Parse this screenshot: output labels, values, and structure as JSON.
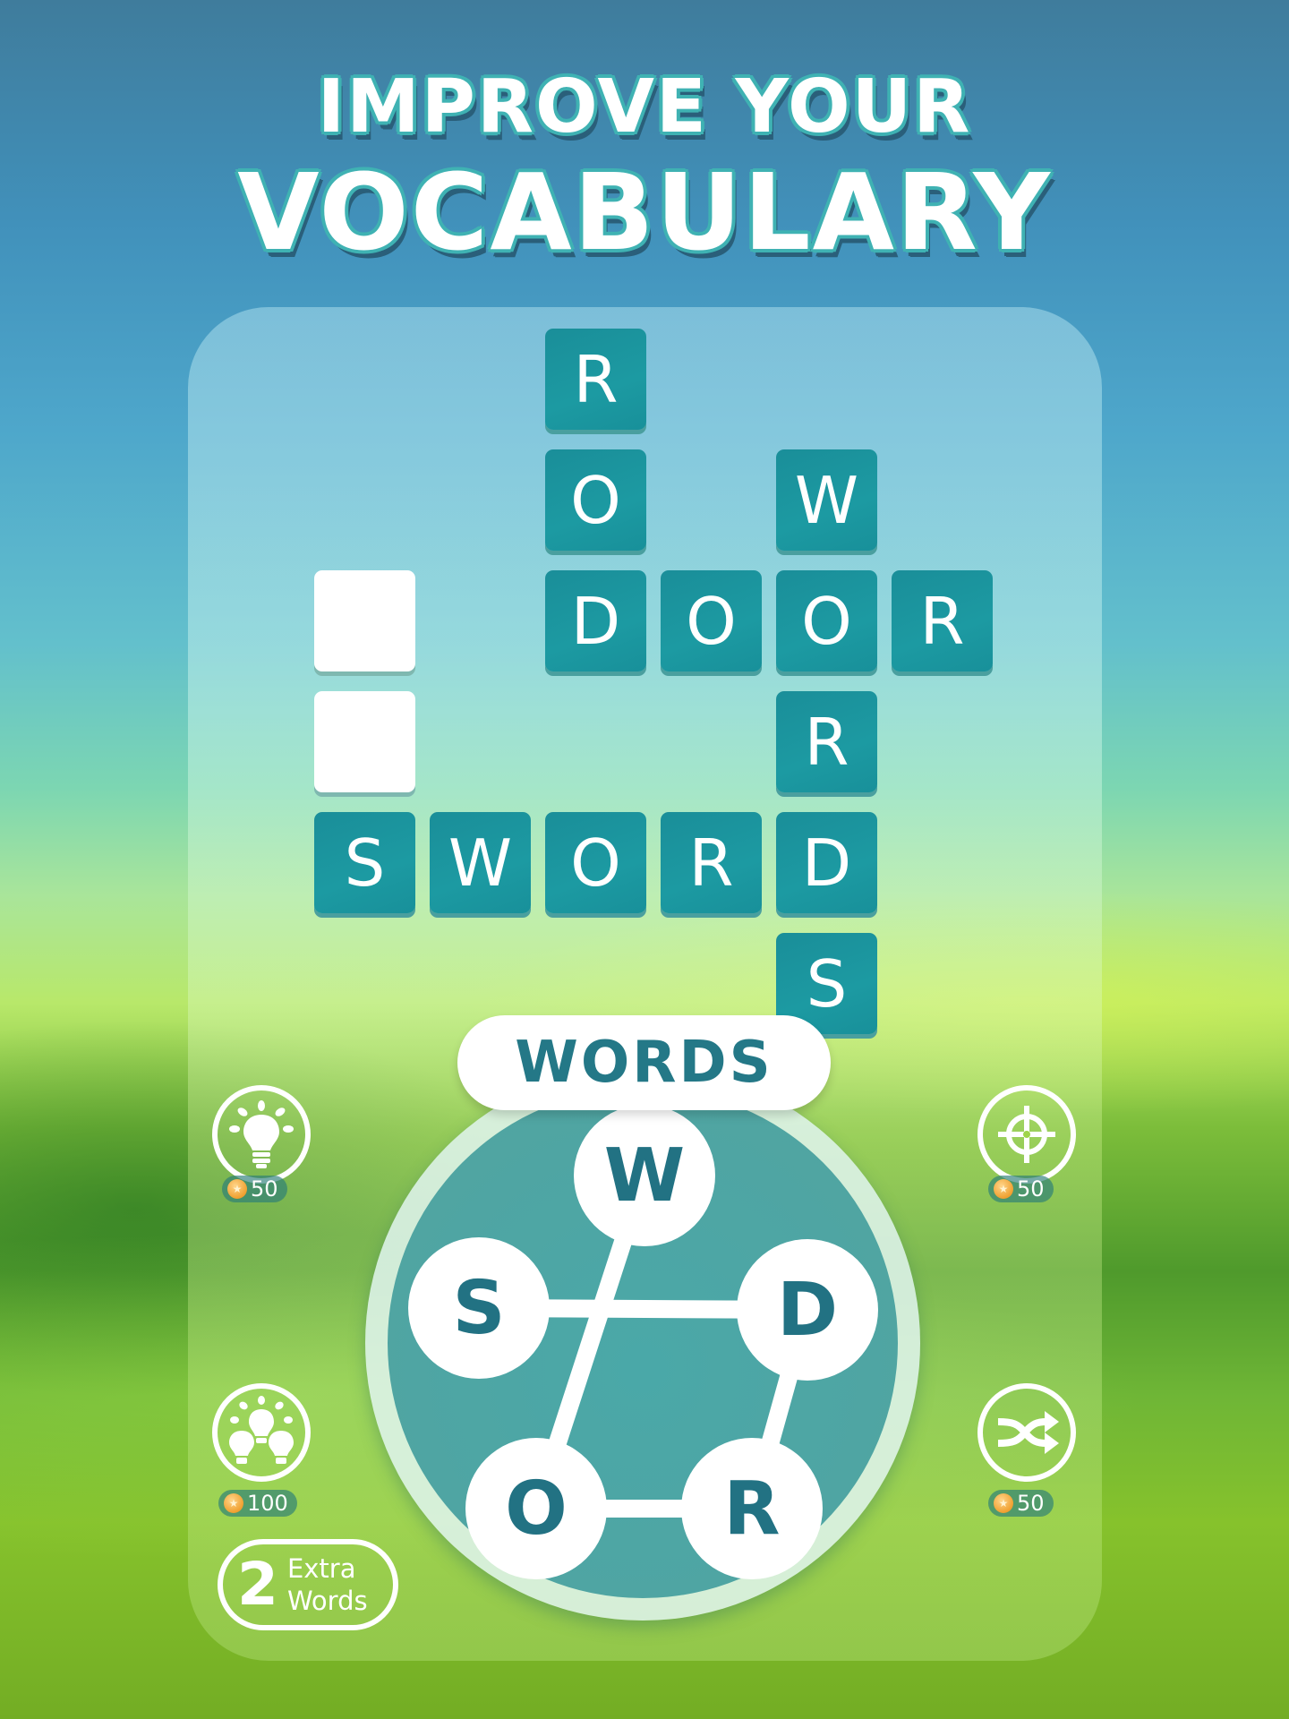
{
  "headline": {
    "line1": "IMPROVE YOUR",
    "line2": "VOCABULARY"
  },
  "board": {
    "tiles": [
      {
        "letter": "R",
        "col": 2,
        "row": 0,
        "state": "filled"
      },
      {
        "letter": "O",
        "col": 2,
        "row": 1,
        "state": "filled"
      },
      {
        "letter": "W",
        "col": 4,
        "row": 1,
        "state": "filled"
      },
      {
        "letter": "",
        "col": 0,
        "row": 2,
        "state": "empty"
      },
      {
        "letter": "D",
        "col": 2,
        "row": 2,
        "state": "filled"
      },
      {
        "letter": "O",
        "col": 3,
        "row": 2,
        "state": "filled"
      },
      {
        "letter": "O",
        "col": 4,
        "row": 2,
        "state": "filled"
      },
      {
        "letter": "R",
        "col": 5,
        "row": 2,
        "state": "filled"
      },
      {
        "letter": "",
        "col": 0,
        "row": 3,
        "state": "empty"
      },
      {
        "letter": "R",
        "col": 4,
        "row": 3,
        "state": "filled"
      },
      {
        "letter": "S",
        "col": 0,
        "row": 4,
        "state": "filled"
      },
      {
        "letter": "W",
        "col": 1,
        "row": 4,
        "state": "filled"
      },
      {
        "letter": "O",
        "col": 2,
        "row": 4,
        "state": "filled"
      },
      {
        "letter": "R",
        "col": 3,
        "row": 4,
        "state": "filled"
      },
      {
        "letter": "D",
        "col": 4,
        "row": 4,
        "state": "filled"
      },
      {
        "letter": "S",
        "col": 4,
        "row": 5,
        "state": "filled"
      }
    ]
  },
  "current_word": "WORDS",
  "wheel": {
    "letters": [
      "W",
      "S",
      "D",
      "O",
      "R"
    ],
    "path": [
      "W",
      "O",
      "R",
      "D",
      "S"
    ]
  },
  "powerups": [
    {
      "name": "hint",
      "icon": "lightbulb-icon",
      "cost": "50"
    },
    {
      "name": "target",
      "icon": "crosshair-icon",
      "cost": "50"
    },
    {
      "name": "multi-hint",
      "icon": "multi-lightbulb-icon",
      "cost": "100"
    },
    {
      "name": "shuffle",
      "icon": "shuffle-icon",
      "cost": "50"
    }
  ],
  "extra_words": {
    "count": "2",
    "line1": "Extra",
    "line2": "Words"
  },
  "colors": {
    "tile": "#1c9aa2",
    "word_text": "#247887",
    "wheel": "#4fa5a3"
  }
}
